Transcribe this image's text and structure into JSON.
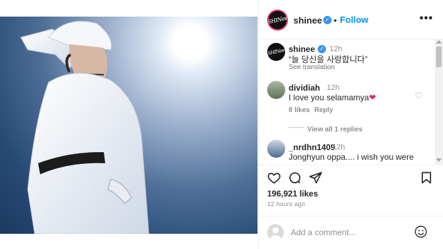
{
  "post": {
    "username": "shinee",
    "separator": "•",
    "follow_label": "Follow",
    "more_label": "•••",
    "avatar_logo_text": "SHINee",
    "like_count": "196,921 likes",
    "posted_ago": "12 hours ago"
  },
  "caption": {
    "username": "shinee",
    "time": "12h",
    "text": "“늘 당신을 사랑합니다”",
    "see_translation": "See translation"
  },
  "comments": [
    {
      "username": "dividiah",
      "time": "12h",
      "text": "I love you selamamya",
      "likes": "8 likes",
      "reply_label": "Reply",
      "avatar_color": "#6b7f62"
    },
    {
      "username": "_nrdhn1409",
      "time": "12h",
      "text": "Jonghyun oppa.... i wish you were",
      "avatar_color": "#7c94b4"
    }
  ],
  "view_replies": "View all 1 replies",
  "add_comment": {
    "placeholder": "Add a comment..."
  },
  "icons": [
    "heart-icon",
    "comment-icon",
    "share-icon",
    "bookmark-icon",
    "emoji-icon",
    "more-icon",
    "verified-icon"
  ],
  "colors": {
    "follow": "#0095f6",
    "verified": "#3897f0",
    "heart_red": "#e0245e"
  }
}
